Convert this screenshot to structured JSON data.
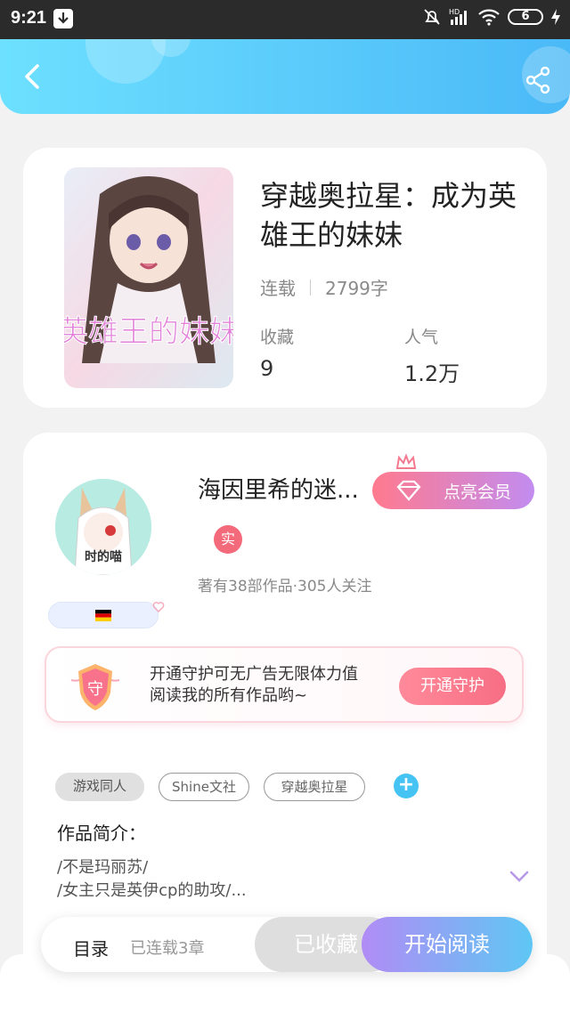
{
  "status_bar": {
    "time": "9:21",
    "battery": "6"
  },
  "header": {
    "back_icon": "chevron-left-icon",
    "share_icon": "share-icon"
  },
  "book": {
    "title": "穿越奥拉星：成为英雄王的妹妹",
    "status": "连载",
    "word_count": "2799字",
    "favorites_label": "收藏",
    "favorites_value": "9",
    "popularity_label": "人气",
    "popularity_value": "1.2万",
    "cover_text": "英雄王的妹妹"
  },
  "author": {
    "name": "海因里希的迷...",
    "vip_button": "点亮会员",
    "verified_badge": "实",
    "works_info": "著有38部作品·305人关注"
  },
  "guard": {
    "icon_text": "守",
    "text": "开通守护可无广告无限体力值阅读我的所有作品哟~",
    "button": "开通守护"
  },
  "tags": [
    "游戏同人",
    "Shine文社",
    "穿越奥拉星"
  ],
  "intro": {
    "heading": "作品简介：",
    "line1": "/不是玛丽苏/",
    "line2": "/女主只是英伊cp的助攻/..."
  },
  "bottom_bar": {
    "toc": "目录",
    "chapters": "已连载3章",
    "collected": "已收藏",
    "read": "开始阅读"
  }
}
